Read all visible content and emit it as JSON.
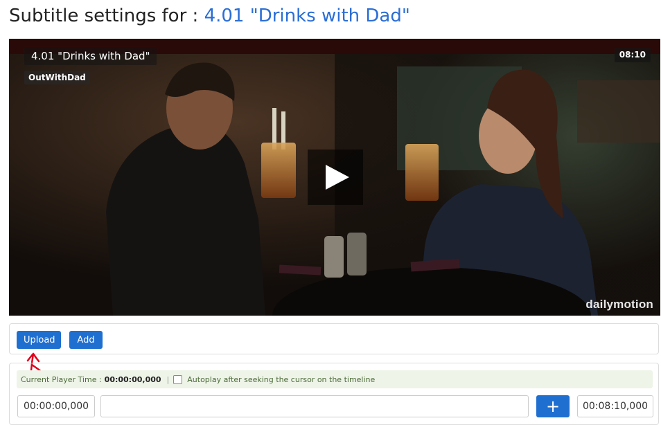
{
  "header": {
    "title_prefix": "Subtitle settings for : ",
    "video_title": "4.01 \"Drinks with Dad\""
  },
  "player": {
    "video_title": "4.01 \"Drinks with Dad\"",
    "channel": "OutWithDad",
    "duration": "08:10",
    "watermark": "dailymotion",
    "play_icon": "play-icon"
  },
  "actions": {
    "upload_label": "Upload",
    "add_label": "Add"
  },
  "timing": {
    "current_time_label": "Current Player Time :",
    "current_time_value": "00:00:00,000",
    "separator": "|",
    "autoplay_label": "Autoplay after seeking the cursor on the timeline",
    "autoplay_checked": false,
    "start_value": "00:00:00,000",
    "subtitle_value": "",
    "add_icon": "+",
    "end_value": "00:08:10,000"
  },
  "colors": {
    "accent": "#1f6fd1",
    "title_link": "#2a6ed6",
    "info_bg": "#eef4e8",
    "annotation": "#e0001a"
  }
}
